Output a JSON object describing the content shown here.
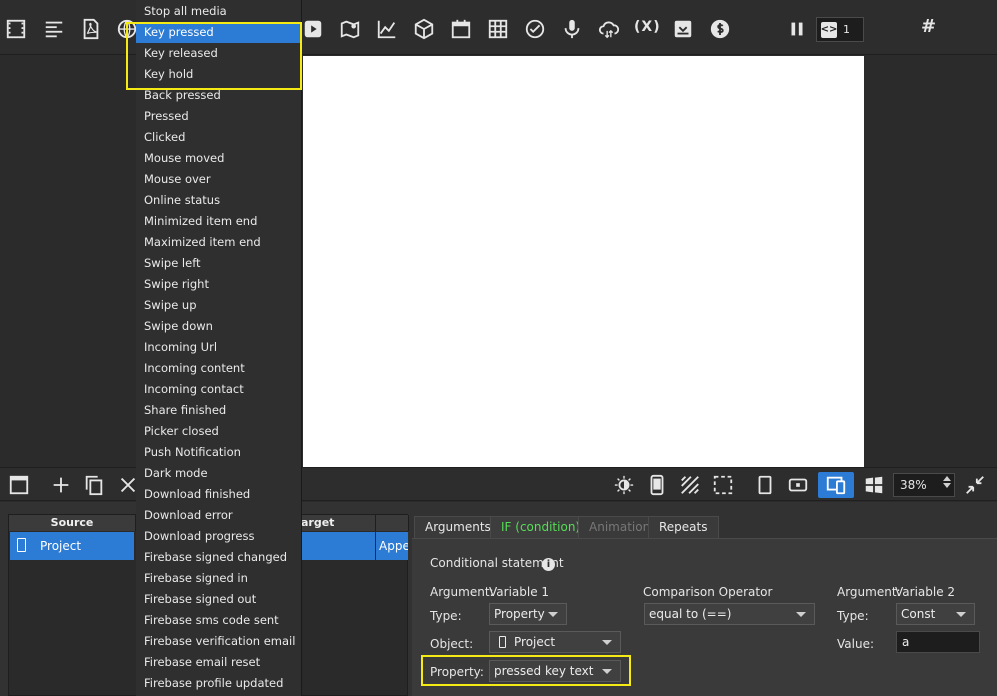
{
  "toolbar": {
    "variables_label": "(X)",
    "screens_tag": "<>",
    "screens_count": "1",
    "hash_label": "#"
  },
  "event_menu": {
    "items": [
      "Stop all media",
      "Key pressed",
      "Key released",
      "Key hold",
      "Back pressed",
      "Pressed",
      "Clicked",
      "Mouse moved",
      "Mouse over",
      "Online status",
      "Minimized item end",
      "Maximized item end",
      "Swipe left",
      "Swipe right",
      "Swipe up",
      "Swipe down",
      "Incoming Url",
      "Incoming content",
      "Incoming contact",
      "Share finished",
      "Picker closed",
      "Push Notification",
      "Dark mode",
      "Download finished",
      "Download error",
      "Download progress",
      "Firebase signed changed",
      "Firebase signed in",
      "Firebase signed out",
      "Firebase sms code sent",
      "Firebase verification email",
      "Firebase email reset",
      "Firebase profile updated"
    ],
    "hovered_index": 1
  },
  "bottom_toolbar": {
    "zoom": "38%"
  },
  "actions_table": {
    "headers": [
      "Source",
      "arget"
    ],
    "row": {
      "source": "Project",
      "event_partial": "Appe"
    }
  },
  "props": {
    "tabs": [
      "Arguments",
      "IF (condition)",
      "Animation",
      "Repeats"
    ],
    "active_tab": "IF (condition)",
    "title": "Conditional statement",
    "info_glyph": "i",
    "arg1_label": "Argument:",
    "arg1_value": "Variable 1",
    "type_label": "Type:",
    "type1_value": "Property",
    "object_label": "Object:",
    "object_value": "Project",
    "property_label": "Property:",
    "property_value": "pressed key text",
    "operator_label": "Comparison Operator",
    "operator_value": "equal to (==)",
    "arg2_label": "Argument:",
    "arg2_value": "Variable 2",
    "type2_label": "Type:",
    "type2_value": "Const",
    "value_label": "Value:",
    "value_value": "a"
  },
  "colors": {
    "accent": "#2c7bd4",
    "highlight": "#f5ea14",
    "active_tab_text": "#55dd55"
  }
}
